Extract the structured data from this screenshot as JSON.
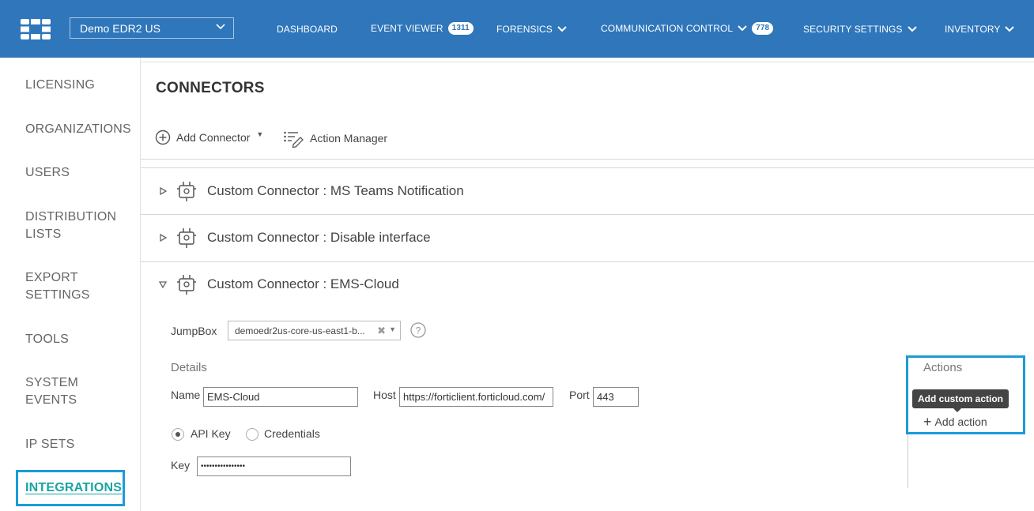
{
  "org_selector": {
    "value": "Demo EDR2 US"
  },
  "nav": {
    "dashboard": "DASHBOARD",
    "event_viewer": "EVENT VIEWER",
    "event_viewer_badge": "1311",
    "forensics": "FORENSICS",
    "communication_control": "COMMUNICATION CONTROL",
    "communication_control_badge": "778",
    "security_settings": "SECURITY SETTINGS",
    "inventory": "INVENTORY"
  },
  "sidebar": {
    "items": [
      {
        "label": "LICENSING"
      },
      {
        "label": "ORGANIZATIONS"
      },
      {
        "label": "USERS"
      },
      {
        "label": "DISTRIBUTION LISTS"
      },
      {
        "label": "EXPORT SETTINGS"
      },
      {
        "label": "TOOLS"
      },
      {
        "label": "SYSTEM EVENTS"
      },
      {
        "label": "IP SETS"
      },
      {
        "label": "INTEGRATIONS",
        "active": true
      }
    ]
  },
  "page": {
    "title": "CONNECTORS",
    "add_connector": "Add Connector",
    "action_manager": "Action Manager"
  },
  "connectors": [
    {
      "name": "Custom Connector : MS Teams Notification",
      "expanded": false
    },
    {
      "name": "Custom Connector : Disable interface",
      "expanded": false
    },
    {
      "name": "Custom Connector : EMS-Cloud",
      "expanded": true
    }
  ],
  "detail": {
    "jumpbox_label": "JumpBox",
    "jumpbox_value": "demoedr2us-core-us-east1-b...",
    "details_label": "Details",
    "name_label": "Name",
    "name_value": "EMS-Cloud",
    "host_label": "Host",
    "host_value": "https://forticlient.forticloud.com/",
    "port_label": "Port",
    "port_value": "443",
    "auth_api_key": "API Key",
    "auth_credentials": "Credentials",
    "auth_selected": "API Key",
    "key_label": "Key",
    "key_value": "••••••••••••••••"
  },
  "actions": {
    "title": "Actions",
    "tooltip": "Add custom action",
    "add_action": "Add action"
  },
  "colors": {
    "topbar": "#2f76bb",
    "active_nav": "#1aa3a3",
    "highlight": "#1a9cd8"
  }
}
